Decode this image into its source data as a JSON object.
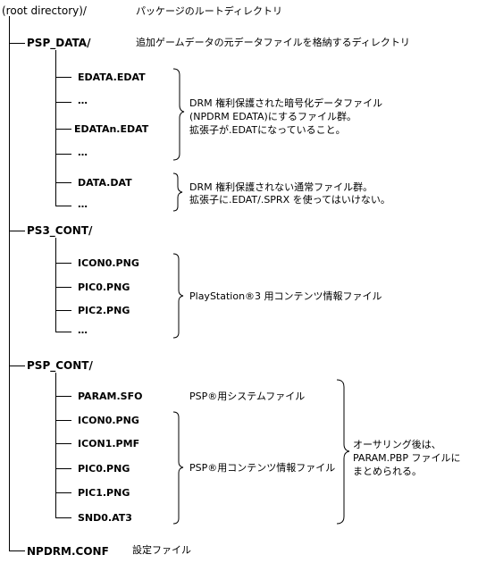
{
  "root": {
    "name": "(root directory)/",
    "desc": "パッケージのルートディレクトリ"
  },
  "psp_data": {
    "name": "PSP_DATA/",
    "desc": "追加ゲームデータの元データファイルを格納するディレクトリ",
    "files": [
      "EDATA.EDAT",
      "…",
      "EDATAn.EDAT",
      "…",
      "DATA.DAT",
      "…"
    ],
    "drm_desc": [
      "DRM 権利保護された暗号化データファイル",
      "(NPDRM EDATA)にするファイル群。",
      "拡張子が.EDATになっていること。"
    ],
    "plain_desc": [
      "DRM 権利保護されない通常ファイル群。",
      "拡張子に.EDAT/.SPRX を使ってはいけない。"
    ]
  },
  "ps3_cont": {
    "name": "PS3_CONT/",
    "files": [
      "ICON0.PNG",
      "PIC0.PNG",
      "PIC2.PNG",
      "…"
    ],
    "desc": "PlayStation®3 用コンテンツ情報ファイル"
  },
  "psp_cont": {
    "name": "PSP_CONT/",
    "files": [
      "PARAM.SFO",
      "ICON0.PNG",
      "ICON1.PMF",
      "PIC0.PNG",
      "PIC1.PNG",
      "SND0.AT3"
    ],
    "param_desc": "PSP®用システムファイル",
    "content_desc": "PSP®用コンテンツ情報ファイル",
    "authoring_note": [
      "オーサリング後は、",
      "PARAM.PBP ファイルに",
      "まとめられる。"
    ]
  },
  "npdrm_conf": {
    "name": "NPDRM.CONF",
    "desc": "設定ファイル"
  }
}
